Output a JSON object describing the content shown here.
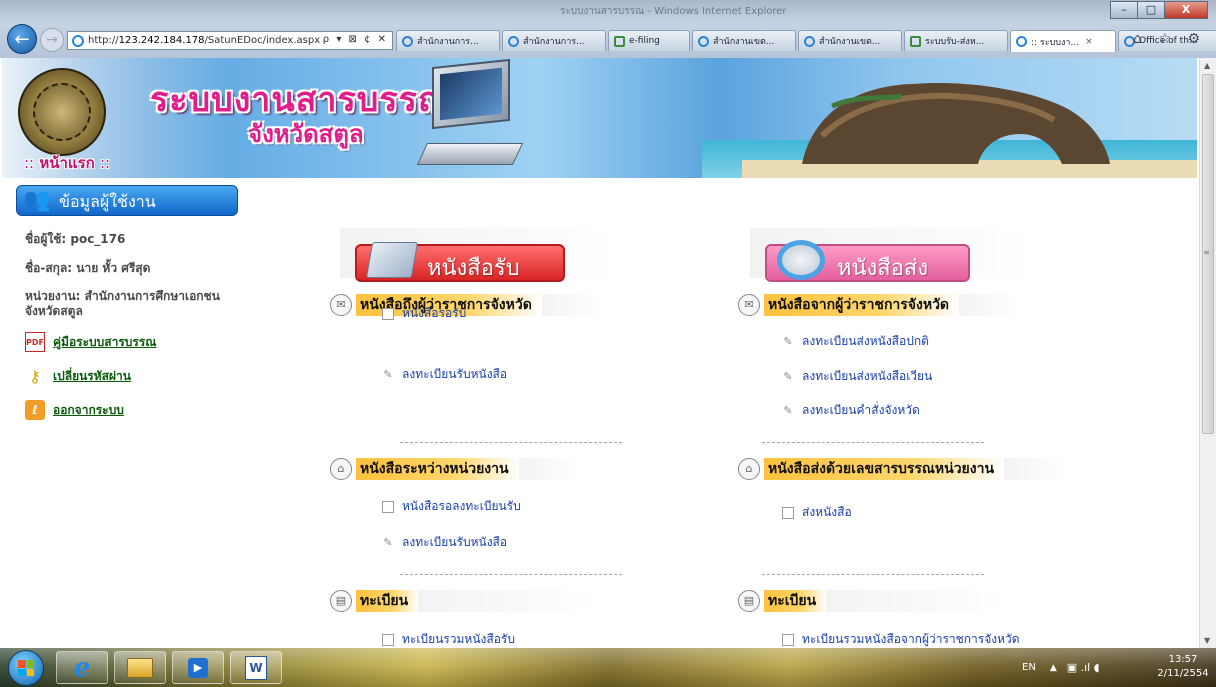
{
  "browser": {
    "window_title": "ระบบงานสารบรรณ - Windows Internet Explorer",
    "url_prefix": "http://",
    "url_host": "123.242.184.178",
    "url_path": "/SatunEDoc/index.aspx",
    "address_tools": "ρ ▾ ⊠ ¢ ✕",
    "tabs": [
      {
        "label": "สำนักงานการ...",
        "icon": "ie-icon",
        "active": false
      },
      {
        "label": "สำนักงานการ...",
        "icon": "ie-icon",
        "active": false
      },
      {
        "label": "e-filing",
        "icon": "mail-icon",
        "active": false
      },
      {
        "label": "สำนักงานเขต...",
        "icon": "ie-icon",
        "active": false
      },
      {
        "label": "สำนักงานเขต...",
        "icon": "ie-icon",
        "active": false
      },
      {
        "label": "ระบบรับ-ส่งห...",
        "icon": "mail-icon",
        "active": false
      },
      {
        "label": ":: ระบบงา...",
        "icon": "ie-icon",
        "active": true
      },
      {
        "label": "Office of th...",
        "icon": "ie-icon",
        "active": false
      }
    ],
    "tab_close": "×",
    "tools": "⌂ ☆ ⚙",
    "window_controls": {
      "minimize": "–",
      "maximize": "□",
      "close": "X"
    },
    "scroll_up": "▲",
    "scroll_down": "▼",
    "scroll_grip": "≡"
  },
  "banner": {
    "title": "ระบบงานสารบรรณ",
    "subtitle": "จังหวัดสตูล",
    "home_prefix": "::",
    "home_label": "หน้าแรก",
    "home_suffix": "::"
  },
  "sidebar": {
    "heading": "ข้อมูลผู้ใช้งาน",
    "username": "ชื่อผู้ใช้: poc_176",
    "fullname": "ชื่อ-สกุล: นาย  หั้ว  ศรีสุด",
    "agency": "หน่วยงาน: สำนักงานการศึกษาเอกชนจังหวัดสตูล",
    "links": [
      {
        "label": "คู่มือระบบสารบรรณ",
        "icon": "pdf-icon",
        "glyph": "PDF"
      },
      {
        "label": "เปลี่ยนรหัสผ่าน",
        "icon": "key-icon",
        "glyph": "⚷"
      },
      {
        "label": "ออกจากระบบ",
        "icon": "logout-icon",
        "glyph": "ℓ"
      }
    ]
  },
  "main": {
    "receive_header": "หนังสือรับ",
    "send_header": "หนังสือส่ง",
    "left_sections": [
      {
        "title": "หนังสือถึงผู้ว่าราชการจังหวัด",
        "items": [
          {
            "label": "หนังสือรอรับ",
            "icon": "doc-icon"
          },
          {
            "label": "ลงทะเบียนรับหนังสือ",
            "icon": "edit-icon"
          }
        ]
      },
      {
        "title": "หนังสือระหว่างหน่วยงาน",
        "items": [
          {
            "label": "หนังสือรอลงทะเบียนรับ",
            "icon": "doc-icon"
          },
          {
            "label": "ลงทะเบียนรับหนังสือ",
            "icon": "edit-icon"
          }
        ]
      },
      {
        "title": "ทะเบียน",
        "items": [
          {
            "label": "ทะเบียนรวมหนังสือรับ",
            "icon": "doc-icon"
          }
        ]
      }
    ],
    "right_sections": [
      {
        "title": "หนังสือจากผู้ว่าราชการจังหวัด",
        "items": [
          {
            "label": "ลงทะเบียนส่งหนังสือปกติ",
            "icon": "edit-icon"
          },
          {
            "label": "ลงทะเบียนส่งหนังสือเวียน",
            "icon": "edit-icon"
          },
          {
            "label": "ลงทะเบียนคำสั่งจังหวัด",
            "icon": "edit-icon"
          }
        ]
      },
      {
        "title": "หนังสือส่งด้วยเลขสารบรรณหน่วยงาน",
        "items": [
          {
            "label": "ส่งหนังสือ",
            "icon": "doc-icon"
          }
        ]
      },
      {
        "title": "ทะเบียน",
        "items": [
          {
            "label": "ทะเบียนรวมหนังสือจากผู้ว่าราชการจังหวัด",
            "icon": "doc-icon"
          }
        ]
      }
    ]
  },
  "taskbar": {
    "media_glyph": "▶",
    "word_glyph": "W",
    "ie_glyph": "e",
    "language": "EN",
    "tray_arrow": "▲",
    "tray_icons": "▣ .ıl ◖",
    "time": "13:57",
    "date": "2/11/2554"
  },
  "colors": {
    "banner_title": "#e21c8a",
    "section_highlight": "#ffc23e",
    "link_blue": "#1a3fa8",
    "sidebar_link_green": "#0b5b0b",
    "receive_pill": "#d92424",
    "send_pill": "#e3609d"
  }
}
